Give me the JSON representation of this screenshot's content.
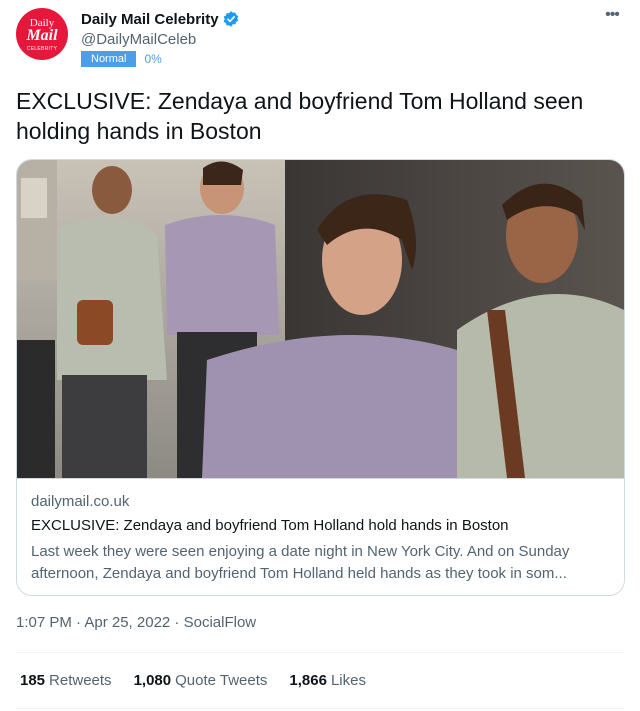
{
  "account": {
    "avatar_line1": "Daily",
    "avatar_line2": "Mail",
    "avatar_line3": "CELEBRITY",
    "display_name": "Daily Mail Celebrity",
    "handle": "@DailyMailCeleb",
    "badge": "Normal",
    "percent": "0%"
  },
  "tweet": {
    "text": "EXCLUSIVE: Zendaya and boyfriend Tom Holland seen holding hands in Boston",
    "time": "1:07 PM · Apr 25, 2022 · SocialFlow"
  },
  "card": {
    "domain": "dailymail.co.uk",
    "title": "EXCLUSIVE: Zendaya and boyfriend Tom Holland hold hands in Boston",
    "description": "Last week they were seen enjoying a date night in New York City. And on Sunday afternoon, Zendaya and boyfriend Tom Holland held hands as they took in som..."
  },
  "stats": {
    "retweets_count": "185",
    "retweets_label": "Retweets",
    "quotes_count": "1,080",
    "quotes_label": "Quote Tweets",
    "likes_count": "1,866",
    "likes_label": "Likes"
  },
  "colors": {
    "brand_red": "#e6173b",
    "verified_blue": "#1d9bf0",
    "badge_blue": "#4c9ee8"
  },
  "icons": {
    "verified": "verified-badge-icon",
    "more": "more-options-icon"
  }
}
